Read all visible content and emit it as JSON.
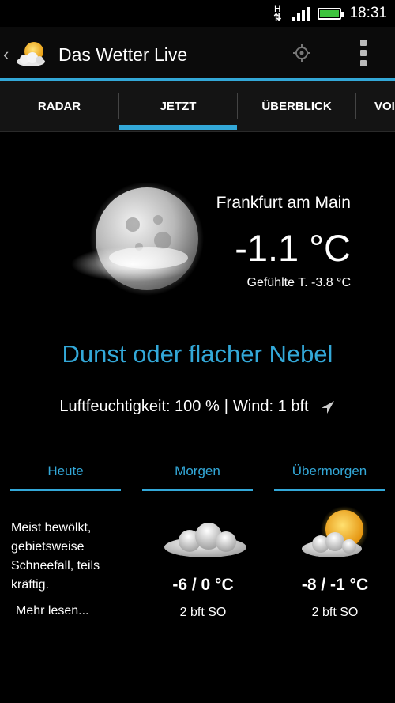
{
  "status_bar": {
    "network": "H",
    "time": "18:31"
  },
  "app": {
    "title": "Das Wetter Live"
  },
  "tabs": [
    {
      "label": "RADAR"
    },
    {
      "label": "JETZT"
    },
    {
      "label": "ÜBERBLICK"
    },
    {
      "label": "VOI"
    }
  ],
  "current": {
    "city": "Frankfurt am Main",
    "temperature": "-1.1 °C",
    "feels_like": "Gefühlte T. -3.8 °C",
    "condition": "Dunst oder flacher Nebel",
    "humidity": "Luftfeuchtigkeit: 100 %",
    "separator": "|",
    "wind": "Wind: 1 bft"
  },
  "forecast": {
    "today": {
      "label": "Heute",
      "text": "Meist bewölkt, gebietsweise Schneefall, teils kräftig.",
      "more": "Mehr lesen..."
    },
    "tomorrow": {
      "label": "Morgen",
      "temp": "-6 / 0 °C",
      "wind": "2 bft  SO"
    },
    "day_after": {
      "label": "Übermorgen",
      "temp": "-8 / -1 °C",
      "wind": "2 bft  SO"
    }
  },
  "colors": {
    "accent": "#33a8d8",
    "background": "#000000",
    "battery": "#3ec43e"
  }
}
